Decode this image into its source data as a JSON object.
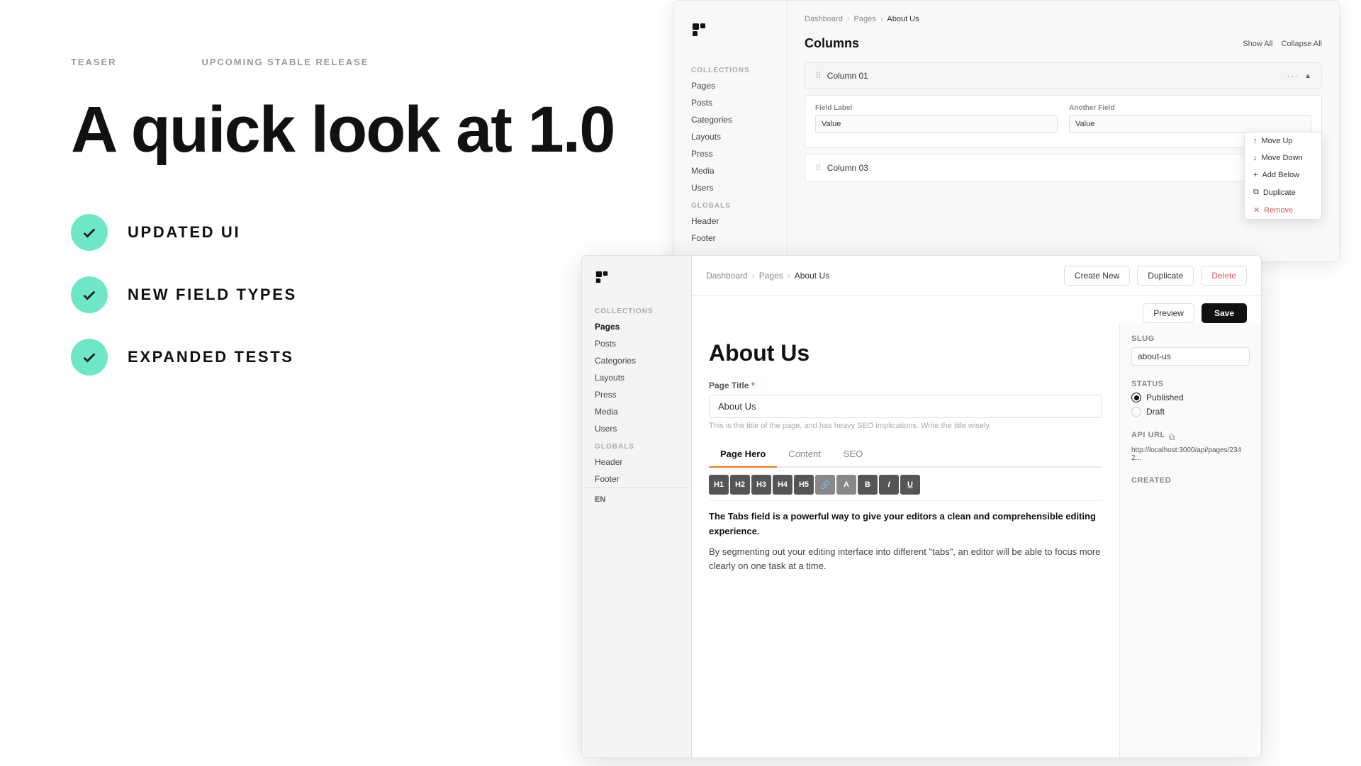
{
  "left": {
    "label_teaser": "TEASER",
    "label_release": "UPCOMING STABLE RELEASE",
    "headline": "A quick look at 1.0",
    "features": [
      {
        "id": "updated-ui",
        "label": "UPDATED UI"
      },
      {
        "id": "new-field-types",
        "label": "NEW FIELD TYPES"
      },
      {
        "id": "expanded-tests",
        "label": "EXPANDED TESTS"
      }
    ]
  },
  "back_panel": {
    "breadcrumb": {
      "dashboard": "Dashboard",
      "pages": "Pages",
      "current": "About Us"
    },
    "columns_title": "Columns",
    "show_all": "Show All",
    "collapse_all": "Collapse All",
    "sidebar": {
      "collections_label": "Collections",
      "items": [
        "Pages",
        "Posts",
        "Categories",
        "Layouts",
        "Press",
        "Media",
        "Users"
      ],
      "globals_label": "Globals",
      "globals_items": [
        "Header",
        "Footer"
      ]
    },
    "column01": {
      "label": "Column 01",
      "fields": [
        {
          "label": "Field Label",
          "value": "Value"
        },
        {
          "label": "Another Field",
          "value": "Value"
        }
      ]
    },
    "column03": {
      "label": "Column 03"
    },
    "context_menu": {
      "items": [
        {
          "id": "move-up",
          "label": "Move Up",
          "danger": false
        },
        {
          "id": "move-down",
          "label": "Move Down",
          "danger": false
        },
        {
          "id": "add-below",
          "label": "Add Below",
          "danger": false
        },
        {
          "id": "duplicate",
          "label": "Duplicate",
          "danger": false
        },
        {
          "id": "remove",
          "label": "Remove",
          "danger": true
        }
      ]
    }
  },
  "front_panel": {
    "breadcrumb": {
      "dashboard": "Dashboard",
      "pages": "Pages",
      "current": "About Us"
    },
    "toolbar": {
      "create_new": "Create New",
      "duplicate": "Duplicate",
      "delete": "Delete",
      "preview": "Preview",
      "save": "Save"
    },
    "page_title": "About Us",
    "field_page_title": {
      "label": "Page Title",
      "required": true,
      "value": "About Us",
      "hint": "This is the title of the page, and has heavy SEO implications. Write the title wisely."
    },
    "tabs": [
      "Page Hero",
      "Content",
      "SEO"
    ],
    "active_tab": "Page Hero",
    "editor": {
      "bold_text": "The Tabs field is a powerful way to give your editors a clean and comprehensible editing experience.",
      "normal_text": "By segmenting out your editing interface into different \"tabs\", an editor will be able to focus more clearly on one task at a time."
    },
    "sidebar": {
      "slug_label": "Slug",
      "slug_value": "about-us",
      "status_label": "Status",
      "status_options": [
        {
          "id": "published",
          "label": "Published",
          "checked": true
        },
        {
          "id": "draft",
          "label": "Draft",
          "checked": false
        }
      ],
      "api_url_label": "API URL",
      "api_url_value": "http://localhost:3000/api/pages/2342...",
      "created_label": "Created"
    },
    "sidebar_nav": {
      "collections_label": "Collections",
      "items": [
        "Pages",
        "Posts",
        "Categories",
        "Layouts",
        "Press",
        "Media",
        "Users"
      ],
      "globals_label": "Globals",
      "globals_items": [
        "Header",
        "Footer"
      ]
    },
    "lang": "EN"
  },
  "colors": {
    "accent_green": "#6ee7c7",
    "accent_orange": "#f97316",
    "primary_dark": "#111111"
  }
}
